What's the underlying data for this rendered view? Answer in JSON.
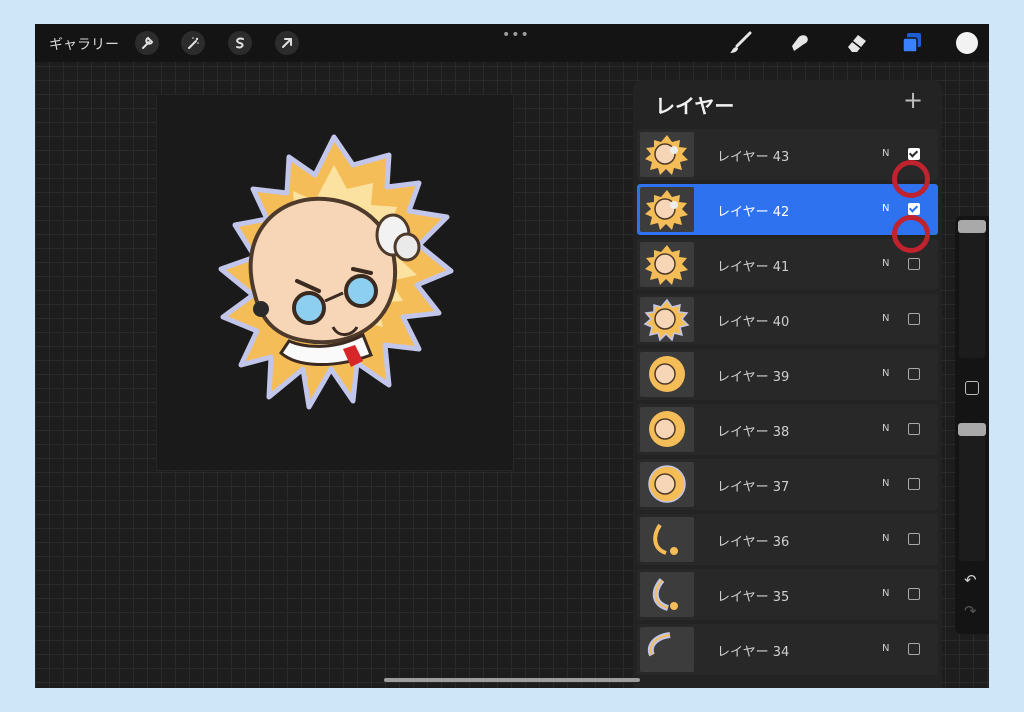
{
  "toolbar": {
    "gallery_label": "ギャラリー",
    "left_tools": [
      "wrench-icon",
      "magic-wand-icon",
      "selection-icon",
      "transform-arrow-icon"
    ],
    "right_tools": [
      "brush-icon",
      "smudge-icon",
      "eraser-icon",
      "layers-icon"
    ],
    "layers_active_color": "#2f72f0",
    "current_color": "#f2f2f2"
  },
  "layers_panel": {
    "title": "レイヤー",
    "add_symbol": "+",
    "layers": [
      {
        "name": "レイヤー 43",
        "blend": "N",
        "visible": true,
        "selected": false,
        "highlighted": true
      },
      {
        "name": "レイヤー 42",
        "blend": "N",
        "visible": true,
        "selected": true,
        "highlighted": true
      },
      {
        "name": "レイヤー 41",
        "blend": "N",
        "visible": false,
        "selected": false,
        "highlighted": false
      },
      {
        "name": "レイヤー 40",
        "blend": "N",
        "visible": false,
        "selected": false,
        "highlighted": false
      },
      {
        "name": "レイヤー 39",
        "blend": "N",
        "visible": false,
        "selected": false,
        "highlighted": false
      },
      {
        "name": "レイヤー 38",
        "blend": "N",
        "visible": false,
        "selected": false,
        "highlighted": false
      },
      {
        "name": "レイヤー 37",
        "blend": "N",
        "visible": false,
        "selected": false,
        "highlighted": false
      },
      {
        "name": "レイヤー 36",
        "blend": "N",
        "visible": false,
        "selected": false,
        "highlighted": false
      },
      {
        "name": "レイヤー 35",
        "blend": "N",
        "visible": false,
        "selected": false,
        "highlighted": false
      },
      {
        "name": "レイヤー 34",
        "blend": "N",
        "visible": false,
        "selected": false,
        "highlighted": false
      }
    ]
  },
  "sidebar": {
    "brush_size_level": 1.0,
    "opacity_level": 1.0,
    "undo_icon": "undo-icon",
    "redo_icon": "redo-icon"
  },
  "colors": {
    "highlight_ring": "#c0222e",
    "selected_row": "#2f72f0",
    "page_background": "#cfe6f8"
  }
}
